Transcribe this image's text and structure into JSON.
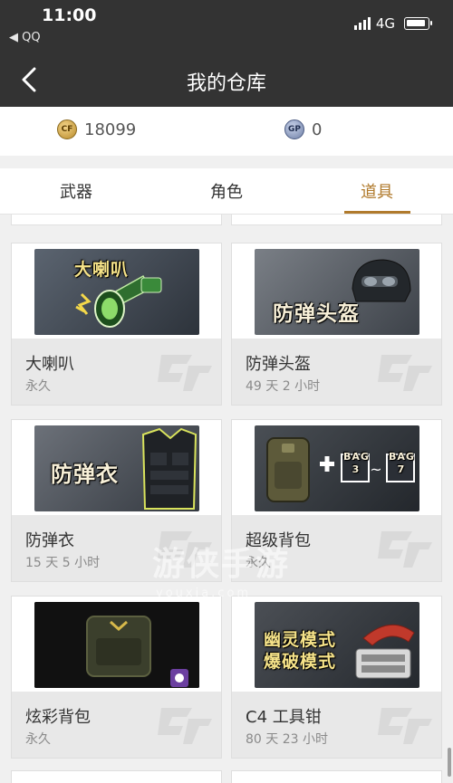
{
  "status": {
    "time": "11:00",
    "back_app": "◀ QQ",
    "network": "4G"
  },
  "nav": {
    "title": "我的仓库"
  },
  "currency": {
    "coin_value": "18099",
    "gp_value": "0",
    "coin_icon_text": "CF",
    "gp_icon_text": "GP"
  },
  "tabs": [
    {
      "label": "武器"
    },
    {
      "label": "角色"
    },
    {
      "label": "道具",
      "active": true
    }
  ],
  "items": [
    {
      "name": "大喇叭",
      "duration": "永久",
      "image_text": "大喇叭"
    },
    {
      "name": "防弹头盔",
      "duration": "49 天 2 小时",
      "image_text": "防弹头盔"
    },
    {
      "name": "防弹衣",
      "duration": "15 天 5 小时",
      "image_text": "防弹衣"
    },
    {
      "name": "超级背包",
      "duration": "永久",
      "image_text_a": "BAG 3",
      "image_text_b": "BAG 7"
    },
    {
      "name": "炫彩背包",
      "duration": "永久"
    },
    {
      "name": "C4 工具钳",
      "duration": "80 天 23 小时",
      "image_text_a": "幽灵模式",
      "image_text_b": "爆破模式"
    }
  ],
  "watermark": {
    "text": "游侠手游",
    "sub": "youxia.com"
  },
  "colors": {
    "accent": "#b07a2c",
    "header": "#333333",
    "card_info": "#e8e8e8"
  }
}
